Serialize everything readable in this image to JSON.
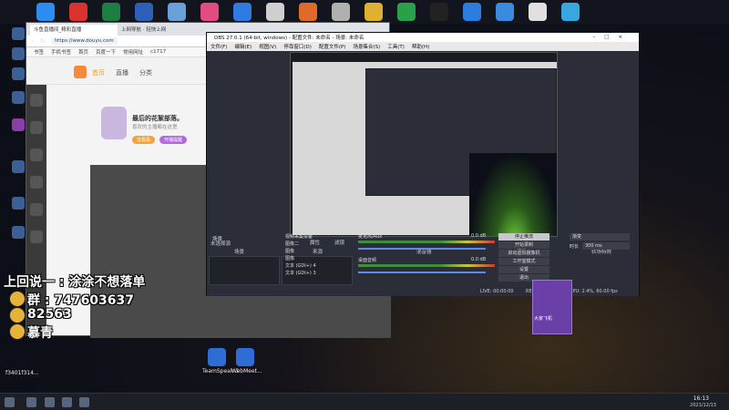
{
  "top_icons": [
    {
      "name": "browser-icon",
      "color": "#2d8cf0"
    },
    {
      "name": "pdf-icon",
      "color": "#d9322f"
    },
    {
      "name": "excel-icon",
      "color": "#1e7d45"
    },
    {
      "name": "word-icon",
      "color": "#2b5fb8"
    },
    {
      "name": "image-icon",
      "color": "#6aa0d8"
    },
    {
      "name": "app-icon",
      "color": "#e34c80"
    },
    {
      "name": "shield-icon",
      "color": "#2f7be0"
    },
    {
      "name": "robot-icon",
      "color": "#cfcfcf"
    },
    {
      "name": "media-icon",
      "color": "#e06a2c"
    },
    {
      "name": "game-icon",
      "color": "#b0b0b0"
    },
    {
      "name": "owl-icon",
      "color": "#e0b030"
    },
    {
      "name": "wechat-icon",
      "color": "#2aa04a"
    },
    {
      "name": "qq-icon",
      "color": "#222222"
    },
    {
      "name": "k-icon",
      "color": "#2d7ce0"
    },
    {
      "name": "mountain-icon",
      "color": "#3a8ae0"
    },
    {
      "name": "chrome-icon",
      "color": "#e0e0e0"
    },
    {
      "name": "bird-icon",
      "color": "#3aa6e0"
    }
  ],
  "browser": {
    "tab_active": "斗鱼直播间_精彩直播",
    "tab_inactive": "上网导航 · 轻快上网",
    "url": "https://www.douyu.com",
    "bookmarks": [
      "书签",
      "手机书签",
      "首页",
      "百度一下",
      "常用网址",
      "c1717"
    ],
    "nav": [
      "首页",
      "直播",
      "分类"
    ],
    "tip_title": "最后的花絮部落。",
    "tip_sub": "喜欢的主播都在这里",
    "tip_btn1": "去看看",
    "tip_btn2": "开播提醒"
  },
  "obs": {
    "title": "OBS 27.0.1 (64-bit, windows) - 配置文件: 未命名 - 场景: 未命名",
    "menu": [
      "文件(F)",
      "编辑(E)",
      "视图(V)",
      "停靠窗口(D)",
      "配置文件(P)",
      "场景集合(S)",
      "工具(T)",
      "帮助(H)"
    ],
    "scene_label": "未选择源",
    "props_btn": "属性",
    "filters_btn": "滤镜",
    "docks": {
      "scenes": "场景",
      "sources": "来源",
      "mixer": "混音器",
      "controls": "控件",
      "transitions": "转场特效"
    },
    "scenes": [
      "场景"
    ],
    "sources": [
      "视频采集设备",
      "图像二",
      "图像",
      "图像",
      "文本 (GDI+) 4",
      "文本 (GDI+) 3"
    ],
    "mixer": [
      {
        "label": "麦克风/Aux",
        "db": "0.0 dB"
      },
      {
        "label": "桌面音频",
        "db": "0.0 dB"
      }
    ],
    "controls": [
      "停止推流",
      "开始录制",
      "启动虚拟摄像机",
      "工作室模式",
      "设置",
      "退出"
    ],
    "transition_value": "渐变",
    "duration_label": "时长",
    "duration_value": "300 ms",
    "status": {
      "live": "LIVE: 00:00:00",
      "rec": "REC: 00:00:00",
      "cpu": "CPU: 2.4%, 60.00 fps"
    }
  },
  "overlay": {
    "line1": "上回说一 : 涂涂不想落单",
    "line2": "群 : 747603637",
    "line3": "82563",
    "line4": "慕青"
  },
  "desktop_apps": [
    {
      "label": "TeamSpeak 3",
      "color": "#2f6dd6"
    },
    {
      "label": "WebMeet...",
      "color": "#2f8ae0"
    }
  ],
  "camera_tile": "大家飞机",
  "desktop_text": "f3401f314...",
  "clock": {
    "time": "16:13",
    "date": "2021/12/13"
  }
}
